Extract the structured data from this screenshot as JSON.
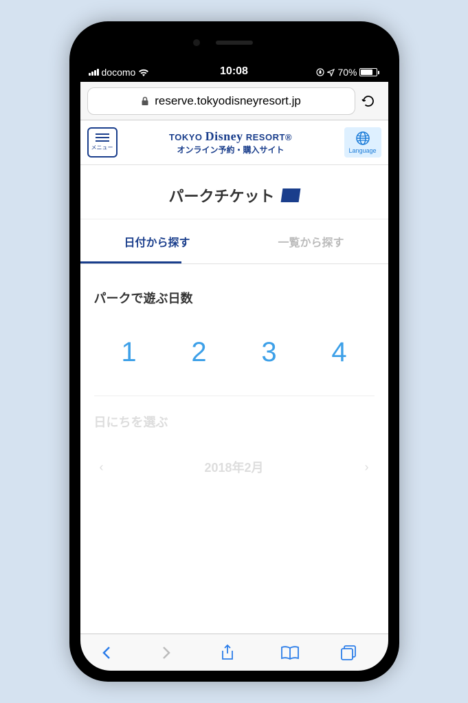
{
  "status": {
    "carrier": "docomo",
    "time": "10:08",
    "battery_pct": "70%",
    "battery_fill_pct": 70
  },
  "browser": {
    "url": "reserve.tokyodisneyresort.jp"
  },
  "header": {
    "menu_label": "メニュー",
    "brand_line1_pre": "TOKYO ",
    "brand_line1_mid": "Disney",
    "brand_line1_post": " RESORT®",
    "brand_line2": "オンライン予約・購入サイト",
    "language_label": "Language"
  },
  "page": {
    "title": "パークチケット"
  },
  "tabs": {
    "tab1": "日付から探す",
    "tab2": "一覧から探す",
    "active_index": 0
  },
  "days": {
    "section_title": "パークで遊ぶ日数",
    "options": [
      "1",
      "2",
      "3",
      "4"
    ]
  },
  "date_section": {
    "title": "日にちを選ぶ",
    "month": "2018年2月"
  }
}
